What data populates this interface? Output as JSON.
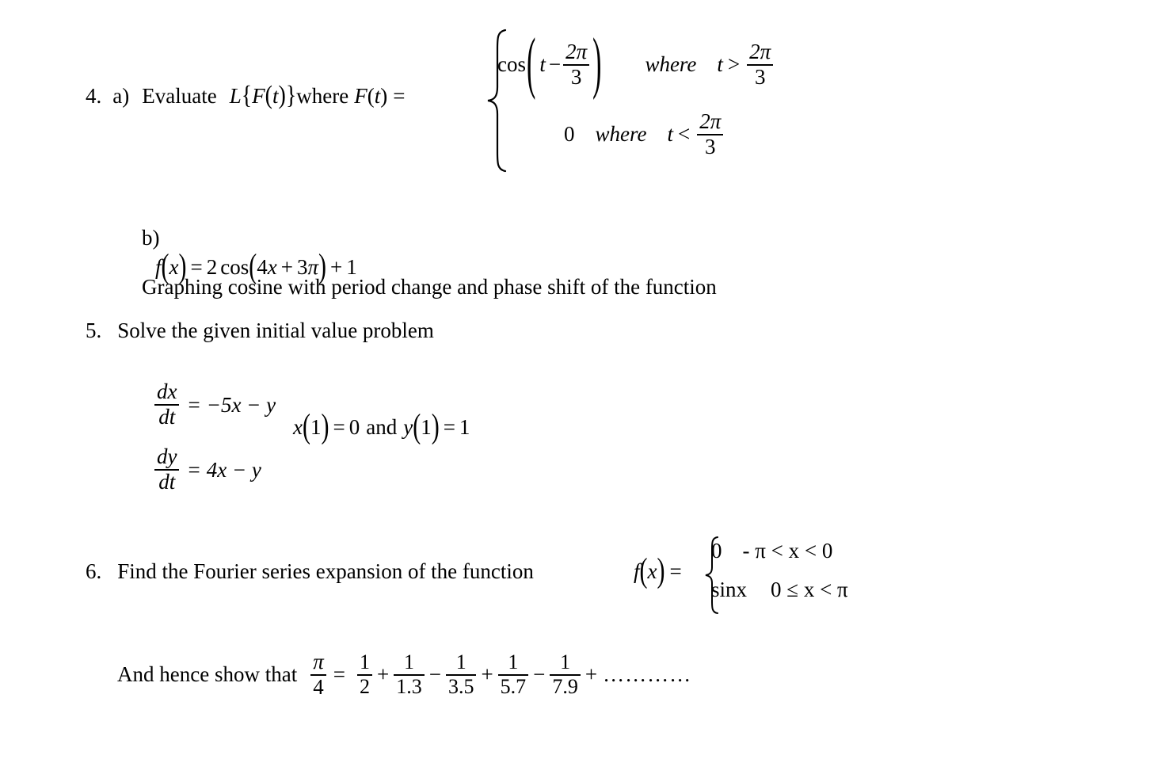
{
  "document": {
    "type": "mathematics-exam-questions",
    "background_color": "#ffffff",
    "text_color": "#000000"
  },
  "q4": {
    "number": "4.",
    "sub_label": "a)",
    "instruction": "Evaluate",
    "operator": "L",
    "brace_open": "{",
    "operand": "F",
    "operand_arg_open": "(",
    "operand_arg": "t",
    "operand_arg_close": ")",
    "brace_close": "}",
    "where_word": "where",
    "function_name": "F",
    "function_arg_open": "(",
    "function_arg": "t",
    "function_arg_close": ")",
    "equals": "=",
    "case1": {
      "cos_label": "cos",
      "paren_open": "(",
      "variable": "t",
      "minus": "−",
      "frac_num": "2π",
      "frac_den": "3",
      "paren_close": ")",
      "where": "where",
      "cond_var": "t",
      "cond_rel": ">",
      "cond_num": "2π",
      "cond_den": "3"
    },
    "case2": {
      "value": "0",
      "where": "where",
      "cond_var": "t",
      "cond_rel": "<",
      "cond_num": "2π",
      "cond_den": "3"
    }
  },
  "q4b": {
    "label": "b)",
    "text": "Graphing cosine with period change and phase shift of the function",
    "equation": {
      "fname": "f",
      "arg_open": "(",
      "arg": "x",
      "arg_close": ")",
      "equals": "=",
      "coefficient": "2",
      "cos_label": "cos",
      "paren_open": "(",
      "inner_coeff": "4",
      "inner_var": "x",
      "plus1": "+",
      "phase_coeff": "3",
      "phase_symbol": "π",
      "paren_close": ")",
      "plus2": "+",
      "constant": "1"
    }
  },
  "q5": {
    "number": "5.",
    "text": "Solve the given initial value problem",
    "eq1": {
      "num": "dx",
      "den": "dt",
      "equals": "=",
      "rhs": "−5x − y"
    },
    "eq2": {
      "num": "dy",
      "den": "dt",
      "equals": "=",
      "rhs": "4x − y"
    },
    "initial_conditions": {
      "x_fn": "x",
      "x_open": "(",
      "x_arg": "1",
      "x_close": ")",
      "x_equals": "=",
      "x_value": "0",
      "conjunction": "and",
      "y_fn": "y",
      "y_open": "(",
      "y_arg": "1",
      "y_close": ")",
      "y_equals": "=",
      "y_value": "1"
    }
  },
  "q6": {
    "number": "6.",
    "text": "Find the Fourier series expansion of the function",
    "fx": {
      "fname": "f",
      "arg_open": "(",
      "arg": "x",
      "arg_close": ")",
      "equals": "="
    },
    "case1": {
      "value": "0",
      "condition": "- π < x < 0"
    },
    "case2": {
      "value": "sinx",
      "condition": "0 ≤ x < π"
    },
    "series": {
      "lead_text": "And hence show that",
      "lhs_num": "π",
      "lhs_den": "4",
      "equals": "=",
      "terms": [
        {
          "op": "",
          "num": "1",
          "den": "2"
        },
        {
          "op": "+",
          "num": "1",
          "den": "1.3"
        },
        {
          "op": "−",
          "num": "1",
          "den": "3.5"
        },
        {
          "op": "+",
          "num": "1",
          "den": "5.7"
        },
        {
          "op": "−",
          "num": "1",
          "den": "7.9"
        }
      ],
      "trailing_op": "+",
      "ellipsis": "…………"
    }
  }
}
